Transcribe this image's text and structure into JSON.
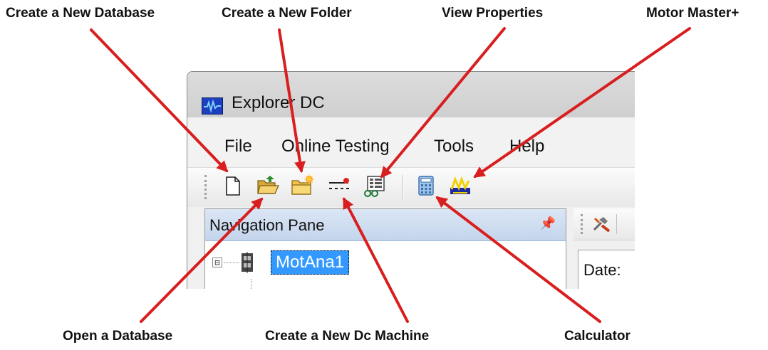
{
  "annotations": {
    "create_database": "Create a New Database",
    "create_folder": "Create a New Folder",
    "view_properties": "View Properties",
    "motor_master": "Motor Master+",
    "open_database": "Open a Database",
    "create_dc_machine": "Create a New Dc Machine",
    "calculator": "Calculator"
  },
  "window": {
    "title": "Explorer DC"
  },
  "menu": {
    "file": "File",
    "online_testing": "Online Testing",
    "tools": "Tools",
    "help": "Help"
  },
  "toolbar": {
    "icons": [
      "new-document-icon",
      "open-folder-icon",
      "new-folder-icon",
      "dc-machine-icon",
      "properties-icon",
      "calculator-icon",
      "motor-master-icon"
    ]
  },
  "navigation_pane": {
    "title": "Navigation Pane",
    "tree": {
      "root_label": "MotAna1",
      "expander": "⊟"
    }
  },
  "right_pane": {
    "date_label": "Date:"
  },
  "colors": {
    "arrow": "#d81e1e",
    "selection": "#3399ff",
    "nav_header": "#c4d5ec"
  }
}
